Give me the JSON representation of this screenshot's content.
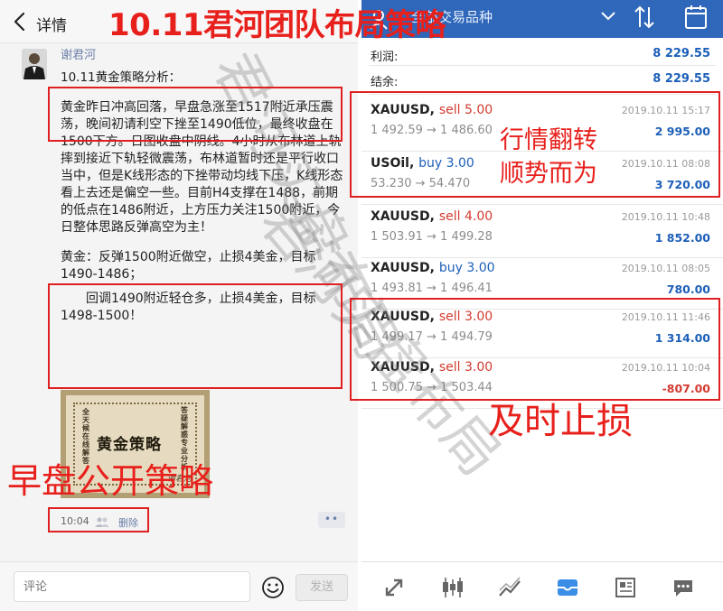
{
  "left": {
    "header": {
      "title": "详情"
    },
    "author": "谢君河",
    "post_head": "10.11黄金策略分析：",
    "paragraphs": [
      "黄金昨日冲高回落，早盘急涨至1517附近承压震荡，晚间初请利空下挫至1490低位，最终收盘在1500下方。日图收盘中阴线。4小时从布林道上轨摔到接近下轨轻微震荡，布林道暂时还是平行收口当中，但是K线形态的下挫带动均线下压，K线形态看上去还是偏空一些。目前H4支撑在1488，前期的低点在1486附近，上方压力关注1500附近，今日整体思路反弹高空为主！",
      "黄金：反弹1500附近做空，止损4美金，目标1490-1486；",
      "回调1490附近轻仓多，止损4美金，目标1498-1500！"
    ],
    "poster": {
      "title": "黄金策略",
      "side_left": "全天候在线解答",
      "side_right": "答疑解惑专业分析",
      "signature": "谢君河"
    },
    "time": "10:04",
    "delete_label": "删除",
    "more_label": "••",
    "comment_placeholder": "评论",
    "send_label": "发送"
  },
  "right": {
    "header": {
      "title": "全部交易品种"
    },
    "summary": [
      {
        "label": "利润:",
        "value": "8 229.55"
      },
      {
        "label": "结余:",
        "value": "8 229.55"
      }
    ],
    "orders": [
      {
        "symbol": "XAUUSD,",
        "side": "sell 5.00",
        "dir": "sell",
        "prices": "1 492.59 → 1 486.60",
        "date": "2019.10.11 15:17",
        "profit": "2 995.00",
        "neg": false
      },
      {
        "symbol": "USOil,",
        "side": "buy 3.00",
        "dir": "buy",
        "prices": "53.230 → 54.470",
        "date": "2019.10.11 08:08",
        "profit": "3 720.00",
        "neg": false
      },
      {
        "symbol": "XAUUSD,",
        "side": "sell 4.00",
        "dir": "sell",
        "prices": "1 503.91 → 1 499.28",
        "date": "2019.10.11 10:48",
        "profit": "1 852.00",
        "neg": false
      },
      {
        "symbol": "XAUUSD,",
        "side": "buy 3.00",
        "dir": "buy",
        "prices": "1 493.81 → 1 496.41",
        "date": "2019.10.11 08:05",
        "profit": "780.00",
        "neg": false
      },
      {
        "symbol": "XAUUSD,",
        "side": "sell 3.00",
        "dir": "sell",
        "prices": "1 499.17 → 1 494.79",
        "date": "2019.10.11 11:46",
        "profit": "1 314.00",
        "neg": false
      },
      {
        "symbol": "XAUUSD,",
        "side": "sell 3.00",
        "dir": "sell",
        "prices": "1 500.75 → 1 503.44",
        "date": "2019.10.11 10:04",
        "profit": "-807.00",
        "neg": true
      }
    ]
  },
  "overlay": {
    "title": "10.11君河团队布局策略",
    "note_reversal_1": "行情翻转",
    "note_reversal_2": "顺势而为",
    "note_stoploss": "及时止损",
    "note_morning": "早盘公开策略",
    "watermark_1": "君河实盘布局",
    "watermark_2": "君河实盘布局"
  },
  "colors": {
    "accent_red": "#e8201c",
    "header_blue": "#2f67ba",
    "profit_blue": "#1d5fb8",
    "sell_red": "#d33a2f",
    "link_blue": "#6c7fa8"
  },
  "icons": [
    "back-icon",
    "people-icon",
    "smile-icon",
    "user-plus-icon",
    "arrows-updown-icon",
    "calendar-icon",
    "quotes-icon",
    "candles-icon",
    "chart-icon",
    "trade-icon",
    "news-icon",
    "chat-icon"
  ]
}
